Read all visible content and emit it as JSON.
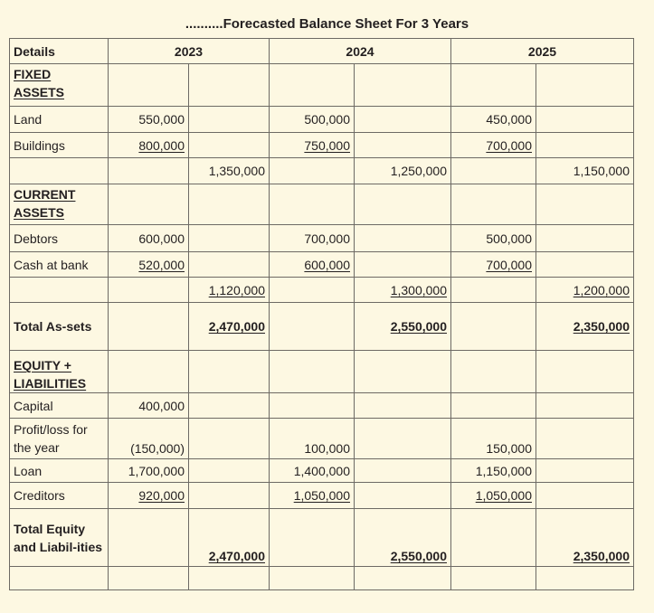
{
  "title": "..........Forecasted Balance Sheet For 3 Years",
  "headers": {
    "details": "Details",
    "y2023": "2023",
    "y2024": "2024",
    "y2025": "2025"
  },
  "fixed_assets": {
    "heading": "FIXED ASSETS",
    "land": {
      "label": "Land",
      "y2023": "550,000",
      "y2024": "500,000",
      "y2025": "450,000"
    },
    "buildings": {
      "label": "Buildings",
      "y2023": "800,000",
      "y2024": "750,000",
      "y2025": "700,000"
    },
    "subtotal": {
      "y2023": "1,350,000",
      "y2024": "1,250,000",
      "y2025": "1,150,000"
    }
  },
  "current_assets": {
    "heading": "CURRENT ASSETS",
    "debtors": {
      "label": "Debtors",
      "y2023": "600,000",
      "y2024": "700,000",
      "y2025": "500,000"
    },
    "cash": {
      "label": "Cash at bank",
      "y2023": "520,000",
      "y2024": "600,000",
      "y2025": "700,000"
    },
    "subtotal": {
      "y2023": "1,120,000",
      "y2024": "1,300,000",
      "y2025": "1,200,000"
    }
  },
  "total_assets": {
    "label": "Total As-sets",
    "y2023": "2,470,000",
    "y2024": "2,550,000",
    "y2025": "2,350,000"
  },
  "equity": {
    "heading": "EQUITY + LIABILITIES",
    "capital": {
      "label": "Capital",
      "y2023": "400,000"
    },
    "profit": {
      "label": "Profit/loss for the year",
      "y2023": "(150,000)",
      "y2024": "100,000",
      "y2025": "150,000"
    },
    "loan": {
      "label": "Loan",
      "y2023": "1,700,000",
      "y2024": "1,400,000",
      "y2025": "1,150,000"
    },
    "creditors": {
      "label": "Creditors",
      "y2023": "920,000",
      "y2024": "1,050,000",
      "y2025": "1,050,000"
    },
    "total": {
      "label": "Total Equity and Liabil-ities",
      "y2023": "2,470,000",
      "y2024": "2,550,000",
      "y2025": "2,350,000"
    }
  }
}
